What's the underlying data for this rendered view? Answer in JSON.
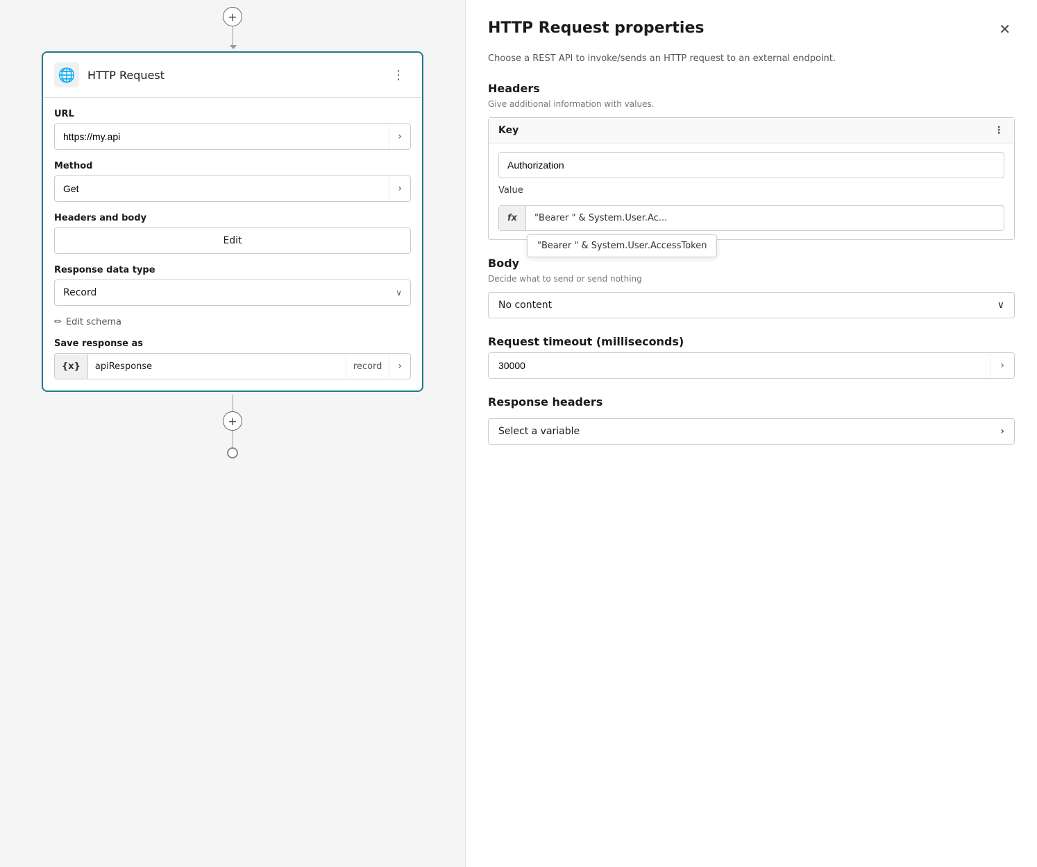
{
  "left": {
    "card_title": "HTTP Request",
    "url_label": "URL",
    "url_value": "https://my.api",
    "method_label": "Method",
    "method_value": "Get",
    "headers_body_label": "Headers and body",
    "headers_body_btn": "Edit",
    "response_type_label": "Response data type",
    "response_type_value": "Record",
    "edit_schema_label": "Edit schema",
    "save_response_label": "Save response as",
    "var_badge": "{x}",
    "var_name": "apiResponse",
    "var_type": "record"
  },
  "right": {
    "panel_title": "HTTP Request properties",
    "panel_description": "Choose a REST API to invoke/sends an HTTP request to an external endpoint.",
    "headers_section_title": "Headers",
    "headers_hint": "Give additional information with values.",
    "headers_key_label": "Key",
    "headers_key_value": "Authorization",
    "headers_value_label": "Value",
    "fx_badge": "fx",
    "fx_value": "\"Bearer \" & System.User.Ac...",
    "tooltip_value": "\"Bearer \" & System.User.AccessToken",
    "body_section_title": "Body",
    "body_hint": "Decide what to send or send nothing",
    "body_value": "No content",
    "timeout_section_title": "Request timeout (milliseconds)",
    "timeout_value": "30000",
    "response_headers_title": "Response headers",
    "response_headers_placeholder": "Select a variable"
  },
  "icons": {
    "globe": "🌐",
    "close": "✕",
    "chevron_down": "∨",
    "chevron_right": "›",
    "plus": "+",
    "pencil": "✏",
    "kebab": "⋮"
  }
}
